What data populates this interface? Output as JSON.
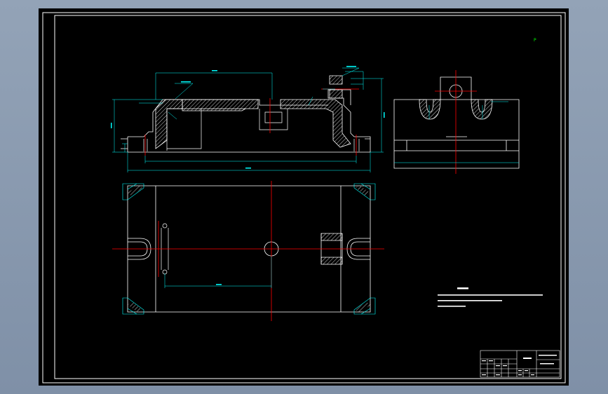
{
  "drawing": {
    "marker": "P",
    "colors": {
      "background": "#000000",
      "frame": "#ffffff",
      "geometry": "#ffffff",
      "dimension": "#00ffff",
      "centerline": "#ff0000",
      "hatch": "#ffffff",
      "marker": "#00ff00",
      "viewport_bg": "#8a9bb0"
    }
  }
}
